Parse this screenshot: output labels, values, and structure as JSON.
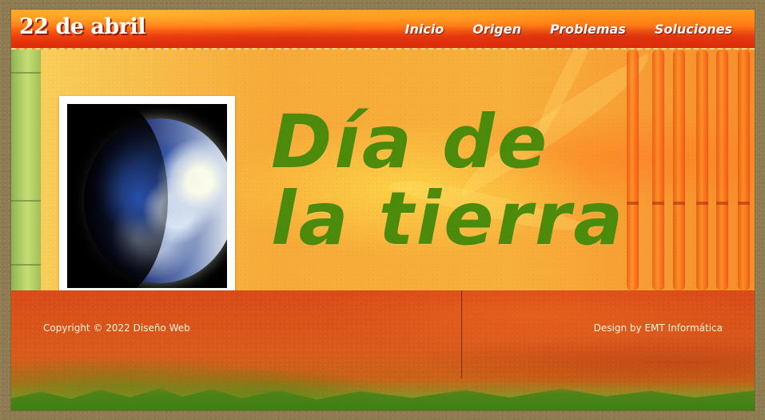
{
  "header": {
    "title": "22 de abril",
    "nav": [
      {
        "label": "Inicio"
      },
      {
        "label": "Origen"
      },
      {
        "label": "Problemas"
      },
      {
        "label": "Soluciones"
      }
    ]
  },
  "hero": {
    "title_line_1": "Día de",
    "title_line_2": "la tierra",
    "image": "earth-photo"
  },
  "footer": {
    "copyright": "Copyright © 2022 Diseño Web",
    "design": "Design by EMT Informática"
  },
  "colors": {
    "accent": "#4c8a0c",
    "header": "#ee3c0e",
    "hero": "#f7aa39",
    "footer": "#d84a18",
    "frame": "#ffffff"
  },
  "icons": [
    "earth-icon"
  ]
}
